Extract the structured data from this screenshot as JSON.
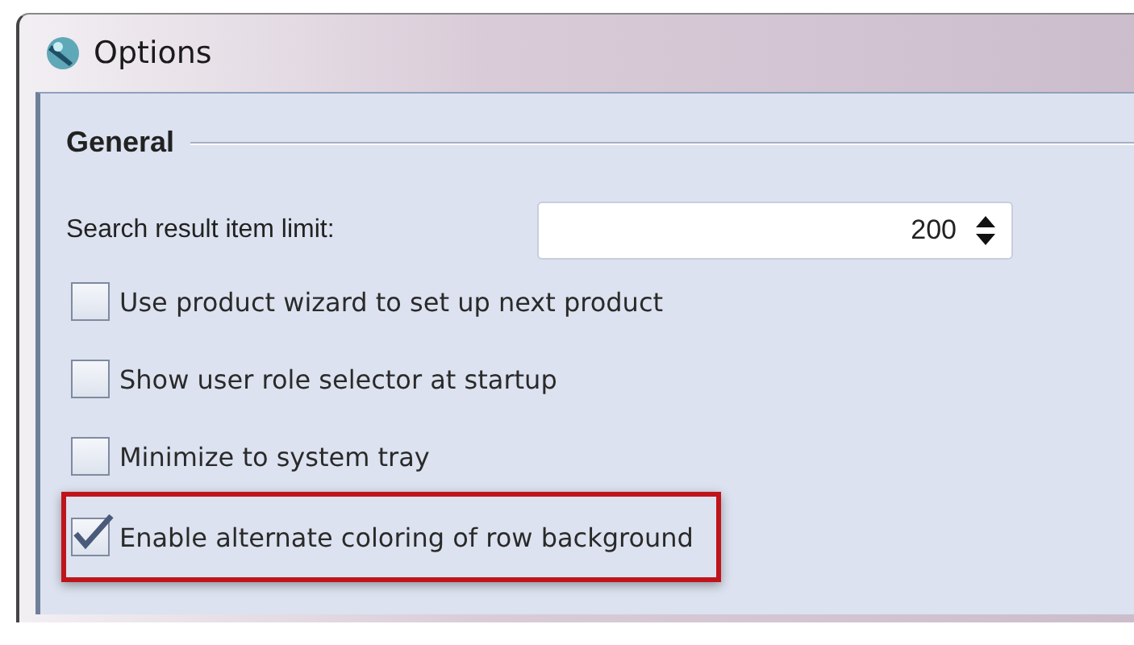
{
  "window": {
    "title": "Options"
  },
  "section": {
    "title": "General"
  },
  "spinner": {
    "label": "Search result item limit:",
    "value": "200"
  },
  "options": [
    {
      "label": "Use product wizard to set up next product",
      "checked": false,
      "highlighted": false
    },
    {
      "label": "Show user role selector at startup",
      "checked": false,
      "highlighted": false
    },
    {
      "label": "Minimize to system tray",
      "checked": false,
      "highlighted": false
    },
    {
      "label": "Enable alternate coloring of row background",
      "checked": true,
      "highlighted": true
    }
  ]
}
